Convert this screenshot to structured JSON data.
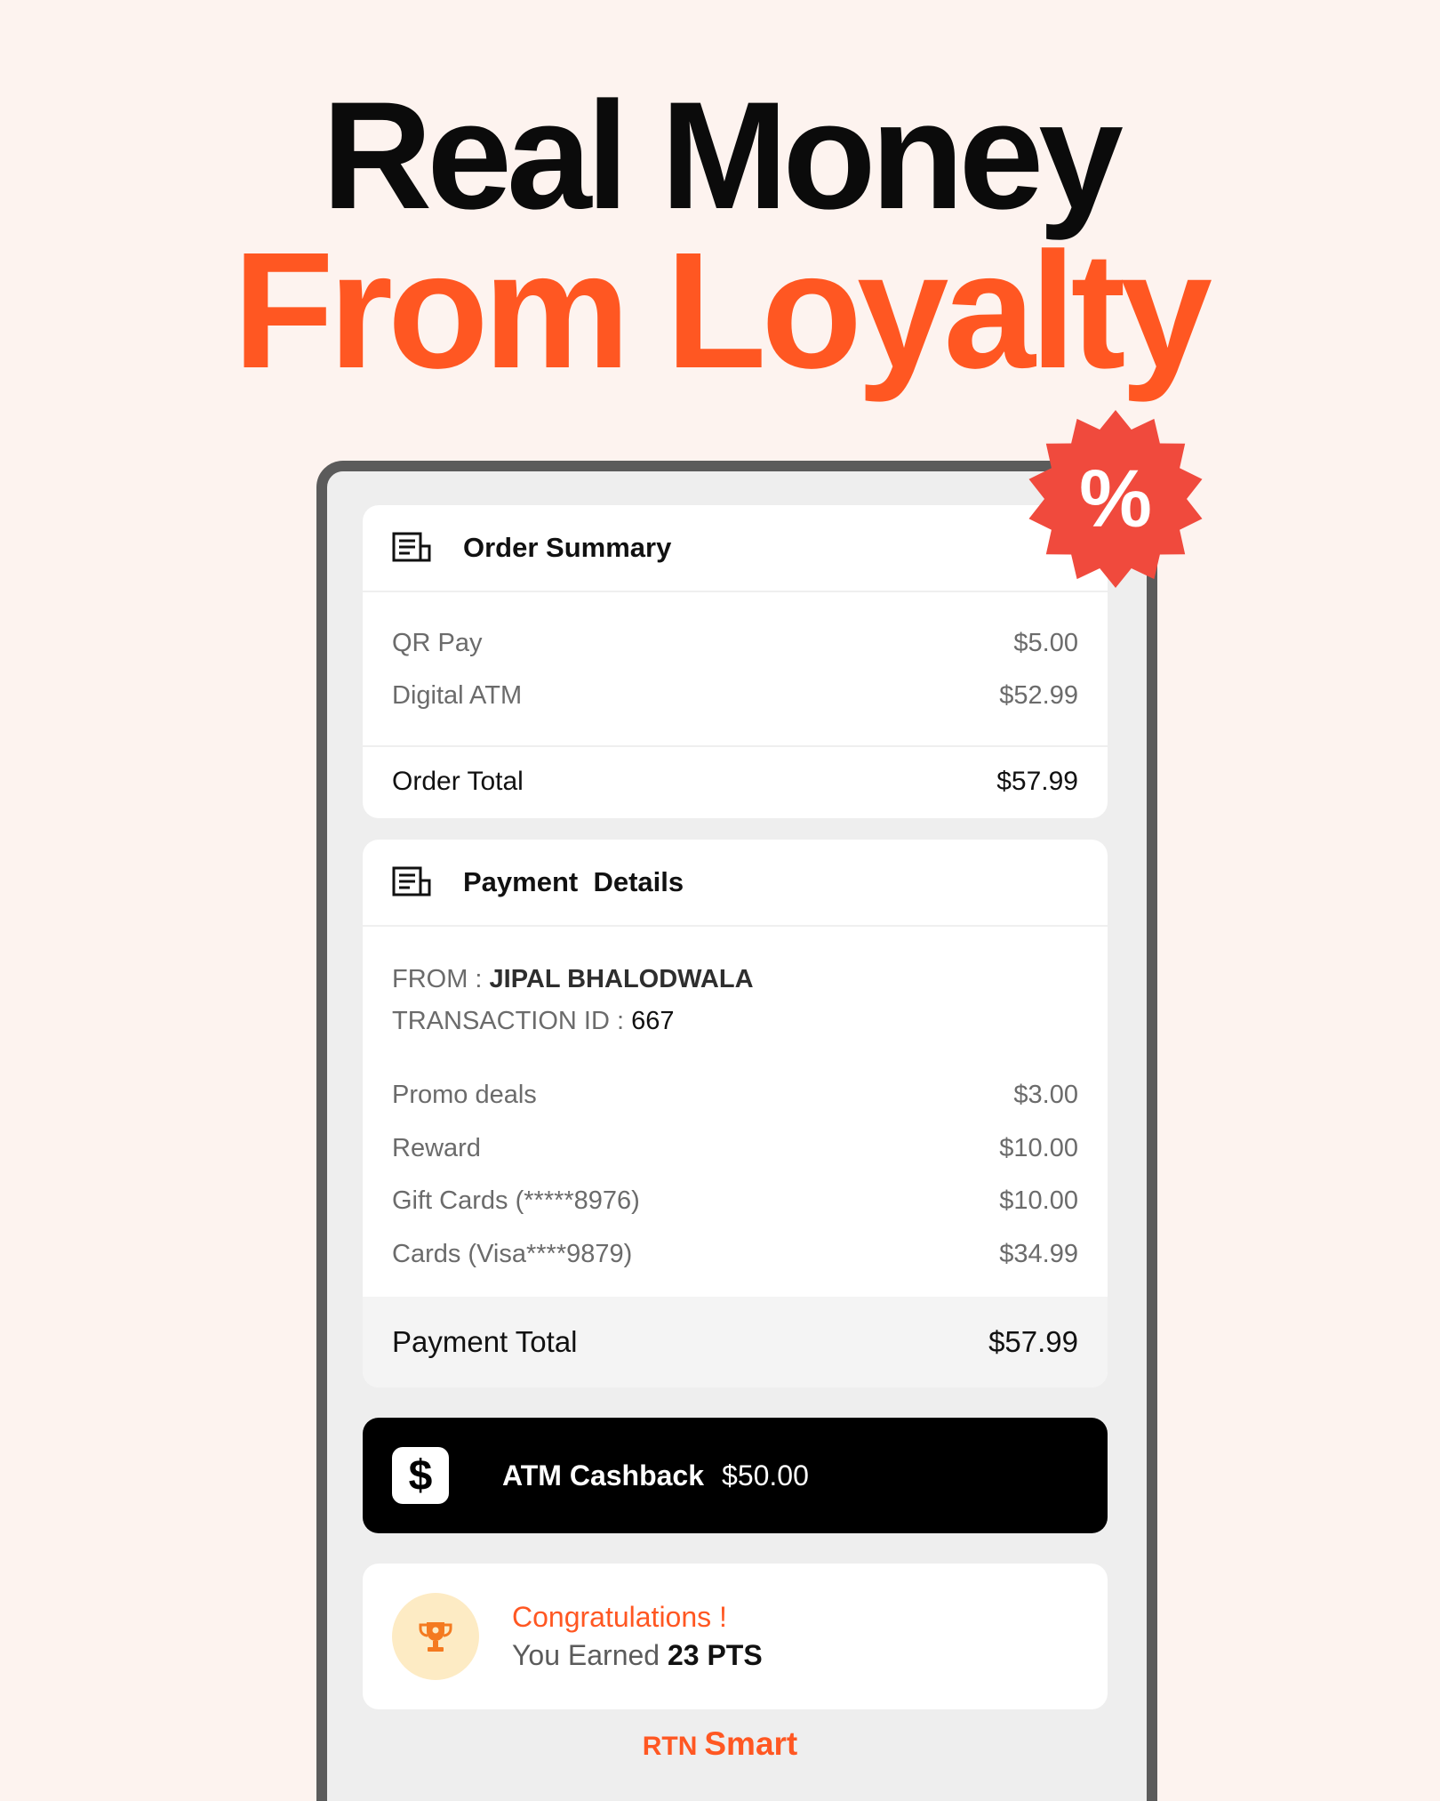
{
  "headline": {
    "line1": "Real Money",
    "line2": "From Loyalty"
  },
  "badge": {
    "symbol": "%",
    "color": "#f04a3d",
    "icon": "percent-badge-icon"
  },
  "order_summary": {
    "title": "Order Summary",
    "icon": "receipt-icon",
    "items": [
      {
        "label": "QR Pay",
        "amount": "$5.00"
      },
      {
        "label": "Digital ATM",
        "amount": "$52.99"
      }
    ],
    "total_label": "Order Total",
    "total_amount": "$57.99"
  },
  "payment_details": {
    "title": "Payment  Details",
    "icon": "receipt-icon",
    "from_label": "FROM : ",
    "from_value": "JIPAL BHALODWALA",
    "txn_label": "TRANSACTION ID : ",
    "txn_value": "667",
    "items": [
      {
        "label": "Promo deals",
        "amount": "$3.00"
      },
      {
        "label": "Reward",
        "amount": "$10.00"
      },
      {
        "label": "Gift Cards (*****8976)",
        "amount": "$10.00"
      },
      {
        "label": "Cards (Visa****9879)",
        "amount": "$34.99"
      }
    ],
    "total_label": "Payment Total",
    "total_amount": "$57.99"
  },
  "cashback": {
    "icon": "dollar-sign-icon",
    "icon_glyph": "$",
    "label": "ATM Cashback",
    "amount": "$50.00"
  },
  "congrats": {
    "icon": "trophy-icon",
    "title": "Congratulations !",
    "earned_prefix": "You Earned ",
    "points": "23 PTS"
  },
  "brand": {
    "prefix": "RTN",
    "name": "Smart"
  },
  "colors": {
    "accent": "#ff5722",
    "background": "#fdf3ef",
    "badge": "#f04a3d"
  }
}
